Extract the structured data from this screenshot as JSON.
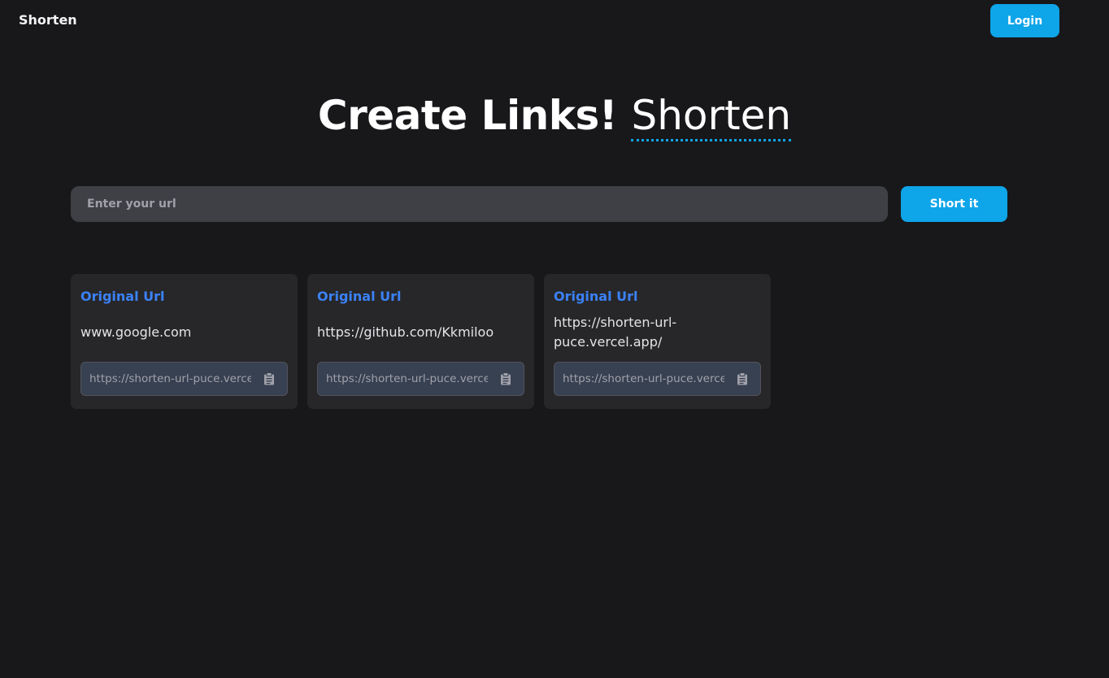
{
  "navbar": {
    "brand": "Shorten",
    "login_label": "Login"
  },
  "hero": {
    "title_strong": "Create Links!",
    "title_accent": "Shorten"
  },
  "form": {
    "placeholder": "Enter your url",
    "value": "",
    "submit_label": "Short it"
  },
  "cards": [
    {
      "title": "Original Url",
      "original_url": "www.google.com",
      "short_url": "https://shorten-url-puce.vercel.",
      "copy_icon": "clipboard-icon"
    },
    {
      "title": "Original Url",
      "original_url": "https://github.com/Kkmiloo",
      "short_url": "https://shorten-url-puce.vercel.",
      "copy_icon": "clipboard-icon"
    },
    {
      "title": "Original Url",
      "original_url": "https://shorten-url-puce.vercel.app/",
      "original_url_line1": "https://shorten-url-",
      "original_url_line2": "puce.vercel.app/",
      "short_url": "https://shorten-url-puce.vercel.",
      "copy_icon": "clipboard-icon"
    }
  ],
  "colors": {
    "background": "#18181b",
    "accent": "#0ea5e9",
    "card_title": "#3b82f6",
    "card_bg": "#27272a",
    "input_bg": "#3f3f46"
  }
}
